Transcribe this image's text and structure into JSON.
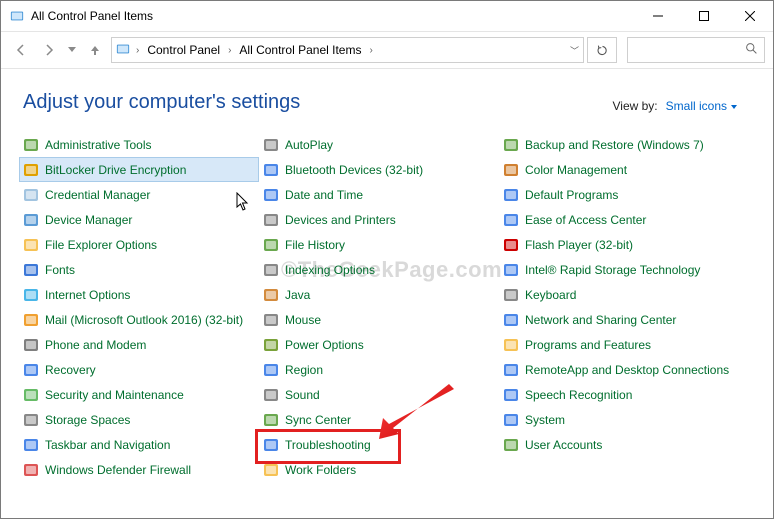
{
  "window_title": "All Control Panel Items",
  "breadcrumb": {
    "root": "Control Panel",
    "current": "All Control Panel Items"
  },
  "header": "Adjust your computer's settings",
  "viewby_label": "View by:",
  "viewby_value": "Small icons",
  "watermark": "©TheGeekPage.com",
  "columns": [
    [
      {
        "icon": "admin",
        "label": "Administrative Tools"
      },
      {
        "icon": "bitlocker",
        "label": "BitLocker Drive Encryption",
        "selected": true
      },
      {
        "icon": "credential",
        "label": "Credential Manager"
      },
      {
        "icon": "device-mgr",
        "label": "Device Manager"
      },
      {
        "icon": "folder-opts",
        "label": "File Explorer Options"
      },
      {
        "icon": "fonts",
        "label": "Fonts"
      },
      {
        "icon": "internet",
        "label": "Internet Options"
      },
      {
        "icon": "mail",
        "label": "Mail (Microsoft Outlook 2016) (32-bit)"
      },
      {
        "icon": "phone",
        "label": "Phone and Modem"
      },
      {
        "icon": "recovery",
        "label": "Recovery"
      },
      {
        "icon": "security",
        "label": "Security and Maintenance"
      },
      {
        "icon": "storage",
        "label": "Storage Spaces"
      },
      {
        "icon": "taskbar",
        "label": "Taskbar and Navigation"
      },
      {
        "icon": "firewall",
        "label": "Windows Defender Firewall"
      }
    ],
    [
      {
        "icon": "autoplay",
        "label": "AutoPlay"
      },
      {
        "icon": "bluetooth",
        "label": "Bluetooth Devices (32-bit)"
      },
      {
        "icon": "datetime",
        "label": "Date and Time"
      },
      {
        "icon": "devices",
        "label": "Devices and Printers"
      },
      {
        "icon": "filehist",
        "label": "File History"
      },
      {
        "icon": "indexing",
        "label": "Indexing Options"
      },
      {
        "icon": "java",
        "label": "Java"
      },
      {
        "icon": "mouse",
        "label": "Mouse"
      },
      {
        "icon": "power",
        "label": "Power Options"
      },
      {
        "icon": "region",
        "label": "Region"
      },
      {
        "icon": "sound",
        "label": "Sound"
      },
      {
        "icon": "sync",
        "label": "Sync Center"
      },
      {
        "icon": "troubleshoot",
        "label": "Troubleshooting",
        "callout": true
      },
      {
        "icon": "workfolders",
        "label": "Work Folders"
      }
    ],
    [
      {
        "icon": "backup",
        "label": "Backup and Restore (Windows 7)"
      },
      {
        "icon": "color",
        "label": "Color Management"
      },
      {
        "icon": "defaults",
        "label": "Default Programs"
      },
      {
        "icon": "ease",
        "label": "Ease of Access Center"
      },
      {
        "icon": "flash",
        "label": "Flash Player (32-bit)"
      },
      {
        "icon": "intel",
        "label": "Intel® Rapid Storage Technology"
      },
      {
        "icon": "keyboard",
        "label": "Keyboard"
      },
      {
        "icon": "network",
        "label": "Network and Sharing Center"
      },
      {
        "icon": "programs",
        "label": "Programs and Features"
      },
      {
        "icon": "remoteapp",
        "label": "RemoteApp and Desktop Connections"
      },
      {
        "icon": "speech",
        "label": "Speech Recognition"
      },
      {
        "icon": "system",
        "label": "System"
      },
      {
        "icon": "users",
        "label": "User Accounts"
      }
    ]
  ]
}
